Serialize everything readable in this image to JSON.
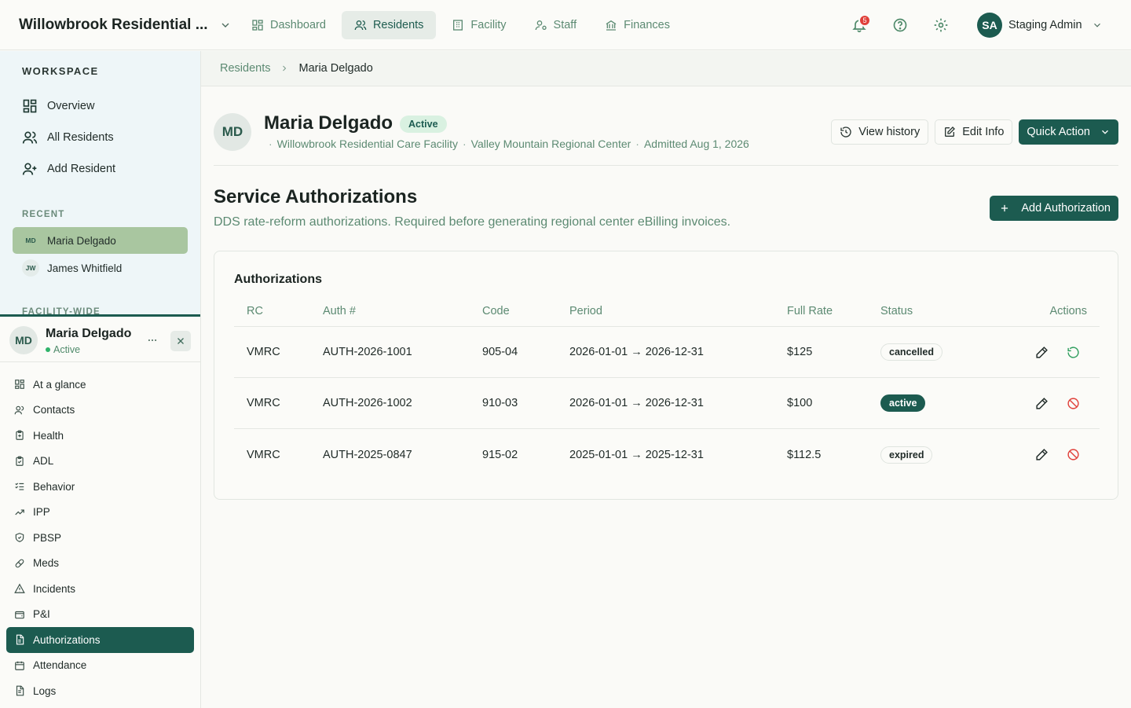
{
  "app": {
    "facility_title": "Willowbrook Residential ...",
    "nav": [
      {
        "label": "Dashboard",
        "icon": "dashboard-icon"
      },
      {
        "label": "Residents",
        "icon": "users-icon"
      },
      {
        "label": "Facility",
        "icon": "building-icon"
      },
      {
        "label": "Staff",
        "icon": "staff-icon"
      },
      {
        "label": "Finances",
        "icon": "bank-icon"
      }
    ],
    "notifications_count": "5",
    "user": {
      "initials": "SA",
      "name": "Staging Admin"
    }
  },
  "sidebar": {
    "workspace_heading": "WORKSPACE",
    "workspace_links": [
      {
        "label": "Overview",
        "icon": "grid-icon"
      },
      {
        "label": "All Residents",
        "icon": "users-icon"
      },
      {
        "label": "Add Resident",
        "icon": "user-plus-icon"
      }
    ],
    "recent_heading": "RECENT",
    "recent": [
      {
        "initials": "MD",
        "name": "Maria Delgado"
      },
      {
        "initials": "JW",
        "name": "James Whitfield"
      }
    ],
    "facility_wide_heading": "FACILITY-WIDE"
  },
  "resident_panel": {
    "initials": "MD",
    "name": "Maria Delgado",
    "status": "Active",
    "items": [
      {
        "label": "At a glance",
        "icon": "grid-icon"
      },
      {
        "label": "Contacts",
        "icon": "users-icon"
      },
      {
        "label": "Health",
        "icon": "clipboard-icon"
      },
      {
        "label": "ADL",
        "icon": "clipboard-check-icon"
      },
      {
        "label": "Behavior",
        "icon": "list-check-icon"
      },
      {
        "label": "IPP",
        "icon": "trending-up-icon"
      },
      {
        "label": "PBSP",
        "icon": "shield-icon"
      },
      {
        "label": "Meds",
        "icon": "pill-icon"
      },
      {
        "label": "Incidents",
        "icon": "alert-triangle-icon"
      },
      {
        "label": "P&I",
        "icon": "wallet-icon"
      },
      {
        "label": "Authorizations",
        "icon": "file-icon"
      },
      {
        "label": "Attendance",
        "icon": "calendar-icon"
      },
      {
        "label": "Logs",
        "icon": "file-text-icon"
      }
    ],
    "active_item": "Authorizations"
  },
  "breadcrumb": {
    "parent": "Residents",
    "current": "Maria Delgado"
  },
  "profile": {
    "initials": "MD",
    "name": "Maria Delgado",
    "status": "Active",
    "facility": "Willowbrook Residential Care Facility",
    "regional_center": "Valley Mountain Regional Center",
    "admitted": "Admitted Aug 1, 2026",
    "view_history_label": "View history",
    "edit_info_label": "Edit Info",
    "quick_action_label": "Quick Action"
  },
  "section": {
    "title": "Service Authorizations",
    "description": "DDS rate-reform authorizations. Required before generating regional center eBilling invoices.",
    "add_label": "Add Authorization"
  },
  "table": {
    "title": "Authorizations",
    "columns": [
      "RC",
      "Auth #",
      "Code",
      "Period",
      "Full Rate",
      "Status",
      "Actions"
    ],
    "rows": [
      {
        "rc": "VMRC",
        "auth": "AUTH-2026-1001",
        "code": "905-04",
        "period": "2026-01-01 → 2026-12-31",
        "rate": "$125",
        "status": "cancelled",
        "second_action": "restore"
      },
      {
        "rc": "VMRC",
        "auth": "AUTH-2026-1002",
        "code": "910-03",
        "period": "2026-01-01 → 2026-12-31",
        "rate": "$100",
        "status": "active",
        "second_action": "cancel"
      },
      {
        "rc": "VMRC",
        "auth": "AUTH-2025-0847",
        "code": "915-02",
        "period": "2025-01-01 → 2025-12-31",
        "rate": "$112.5",
        "status": "expired",
        "second_action": "cancel"
      }
    ]
  },
  "colors": {
    "primary": "#1c5b50",
    "accent_text": "#5c8a72",
    "danger": "#e0403a"
  }
}
